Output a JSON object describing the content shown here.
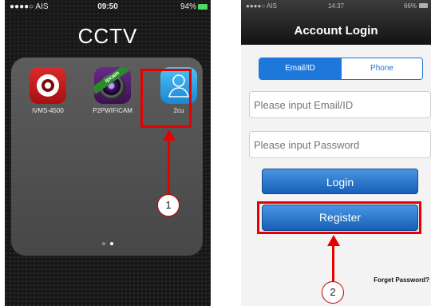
{
  "left_screen": {
    "status_bar": {
      "carrier": "●●●●○ AIS",
      "time": "09:50",
      "battery": "94%"
    },
    "folder_title": "CCTV",
    "apps": [
      {
        "label": "iVMS-4500",
        "icon": "ivms-app-icon"
      },
      {
        "label": "P2PWIFICAM",
        "icon": "p2pwificam-app-icon",
        "badge": "ipcam"
      },
      {
        "label": "2cu",
        "icon": "2cu-app-icon"
      }
    ],
    "page_dots": 2,
    "callout_number": "1"
  },
  "right_screen": {
    "status_bar": {
      "carrier": "●●●●○ AIS",
      "time": "14:37",
      "battery": "66%"
    },
    "title": "Account Login",
    "segmented_control": {
      "options": [
        "Email/ID",
        "Phone"
      ],
      "selected": "Email/ID"
    },
    "email_placeholder": "Please input Email/ID",
    "password_placeholder": "Please input Password",
    "login_label": "Login",
    "register_label": "Register",
    "forget_password_label": "Forget Password?",
    "callout_number": "2"
  },
  "colors": {
    "highlight": "#e60000",
    "button_blue": "#1e78dc",
    "segment_blue": "#1e73d4"
  }
}
